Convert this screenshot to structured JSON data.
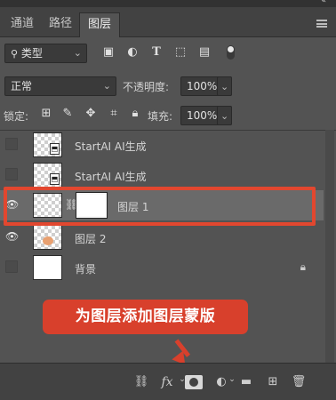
{
  "tabs": [
    {
      "label": "通道"
    },
    {
      "label": "路径"
    },
    {
      "label": "图层"
    }
  ],
  "filter": {
    "kind_label": "类型"
  },
  "blend": {
    "mode": "正常",
    "opacity_label": "不透明度:",
    "opacity_value": "100%"
  },
  "lock": {
    "label": "锁定:",
    "fill_label": "填充:",
    "fill_value": "100%"
  },
  "layers": [
    {
      "name": "StartAI AI生成",
      "visible": false
    },
    {
      "name": "StartAI AI生成",
      "visible": false
    },
    {
      "name": "图层 1",
      "visible": true,
      "selected": true,
      "has_mask": true
    },
    {
      "name": "图层 2",
      "visible": true
    },
    {
      "name": "背景",
      "visible": false,
      "locked": true
    }
  ],
  "callout": {
    "text": "为图层添加图层蒙版"
  },
  "colors": {
    "panel": "#535353",
    "tabbar": "#424242",
    "highlight": "#e2472f",
    "callout": "#d8402c",
    "selected_row": "#6a6a6a"
  },
  "icons": [
    "search-icon",
    "image-filter-icon",
    "adjustment-filter-icon",
    "type-filter-icon",
    "shape-filter-icon",
    "smart-object-filter-icon",
    "filter-toggle-icon",
    "eye-icon",
    "link-icon",
    "fx-icon",
    "add-mask-icon",
    "new-adjustment-icon",
    "new-group-icon",
    "new-layer-icon",
    "trash-icon",
    "lock-icon"
  ]
}
